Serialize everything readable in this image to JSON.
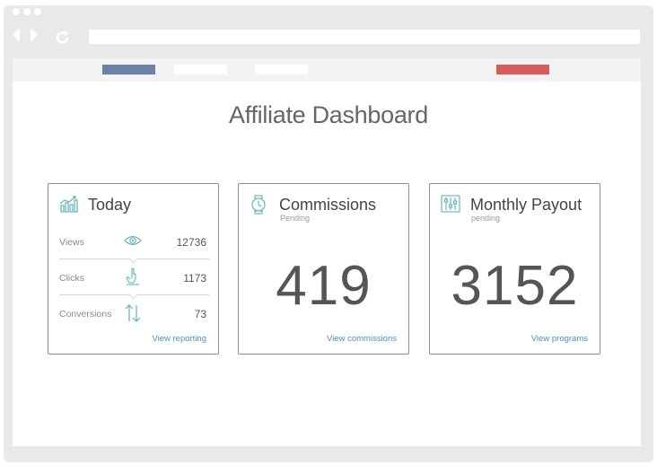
{
  "browser": {
    "toolbar_colors": {
      "primary": "#6a82a8",
      "danger": "#d95c5c",
      "neutral": "#ffffff"
    }
  },
  "page": {
    "title": "Affiliate Dashboard"
  },
  "today_card": {
    "title": "Today",
    "icon": "bar-chart-icon",
    "rows": [
      {
        "label": "Views",
        "icon": "eye-icon",
        "value": "12736"
      },
      {
        "label": "Clicks",
        "icon": "pointer-icon",
        "value": "1173"
      },
      {
        "label": "Conversions",
        "icon": "arrows-updown-icon",
        "value": "73"
      }
    ],
    "link": "View reporting"
  },
  "commissions_card": {
    "title": "Commissions",
    "subtitle": "Pending",
    "icon": "watch-icon",
    "value": "419",
    "link": "View commissions"
  },
  "payout_card": {
    "title": "Monthly Payout",
    "subtitle": "pending",
    "icon": "sliders-icon",
    "value": "3152",
    "link": "View programs"
  },
  "accent_color": "#4a90c8"
}
